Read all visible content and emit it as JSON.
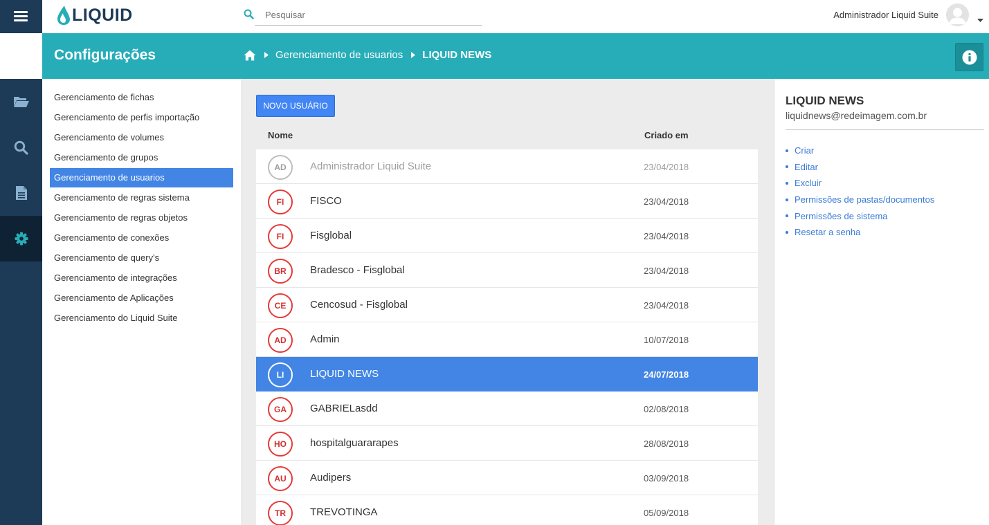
{
  "app": {
    "logo_text": "LIQUID",
    "brand_color": "#26adb8",
    "nav_color": "#1d3a57",
    "selection_color": "#4285e4"
  },
  "topbar": {
    "search_placeholder": "Pesquisar",
    "user_name": "Administrador Liquid Suite"
  },
  "header": {
    "title": "Configurações",
    "breadcrumb": [
      "Gerenciamento de usuarios",
      "LIQUID NEWS"
    ]
  },
  "rail": {
    "items": [
      {
        "icon": "folder-open-icon",
        "active": false
      },
      {
        "icon": "search-icon",
        "active": false
      },
      {
        "icon": "document-icon",
        "active": false
      },
      {
        "icon": "gear-icon",
        "active": true
      }
    ]
  },
  "settings_menu": {
    "items": [
      {
        "label": "Gerenciamento de fichas",
        "active": false
      },
      {
        "label": "Gerenciamento de perfis importação",
        "active": false
      },
      {
        "label": "Gerenciamento de volumes",
        "active": false
      },
      {
        "label": "Gerenciamento de grupos",
        "active": false
      },
      {
        "label": "Gerenciamento de usuarios",
        "active": true
      },
      {
        "label": "Gerenciamento de regras sistema",
        "active": false
      },
      {
        "label": "Gerenciamento de regras objetos",
        "active": false
      },
      {
        "label": "Gerenciamento de conexões",
        "active": false
      },
      {
        "label": "Gerenciamento de query's",
        "active": false
      },
      {
        "label": "Gerenciamento de integrações",
        "active": false
      },
      {
        "label": "Gerenciamento de Aplicações",
        "active": false
      },
      {
        "label": "Gerenciamento do Liquid Suite",
        "active": false
      }
    ]
  },
  "main": {
    "new_user_label": "NOVO USUÁRIO",
    "columns": {
      "name": "Nome",
      "created": "Criado em"
    },
    "users": [
      {
        "initials": "AD",
        "name": "Administrador Liquid Suite",
        "created": "23/04/2018",
        "state": "disabled"
      },
      {
        "initials": "FI",
        "name": "FISCO",
        "created": "23/04/2018",
        "state": "normal"
      },
      {
        "initials": "FI",
        "name": "Fisglobal",
        "created": "23/04/2018",
        "state": "normal"
      },
      {
        "initials": "BR",
        "name": "Bradesco - Fisglobal",
        "created": "23/04/2018",
        "state": "normal"
      },
      {
        "initials": "CE",
        "name": "Cencosud - Fisglobal",
        "created": "23/04/2018",
        "state": "normal"
      },
      {
        "initials": "AD",
        "name": "Admin",
        "created": "10/07/2018",
        "state": "normal"
      },
      {
        "initials": "LI",
        "name": "LIQUID NEWS",
        "created": "24/07/2018",
        "state": "selected"
      },
      {
        "initials": "GA",
        "name": "GABRIELasdd",
        "created": "02/08/2018",
        "state": "normal"
      },
      {
        "initials": "HO",
        "name": "hospitalguararapes",
        "created": "28/08/2018",
        "state": "normal"
      },
      {
        "initials": "AU",
        "name": "Audipers",
        "created": "03/09/2018",
        "state": "normal"
      },
      {
        "initials": "TR",
        "name": "TREVOTINGA",
        "created": "05/09/2018",
        "state": "normal"
      }
    ]
  },
  "detail": {
    "name": "LIQUID NEWS",
    "email": "liquidnews@redeimagem.com.br",
    "actions": [
      "Criar",
      "Editar",
      "Excluir",
      "Permissões de pastas/documentos",
      "Permissões de sistema",
      "Resetar a senha"
    ]
  }
}
